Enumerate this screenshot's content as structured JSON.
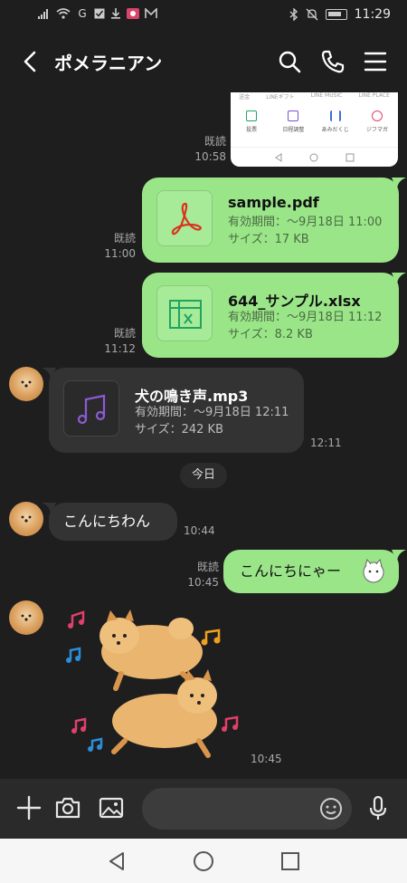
{
  "status": {
    "time": "11:29"
  },
  "header": {
    "title": "ポメラニアン"
  },
  "screenshot_preview": {
    "items": [
      "投票",
      "日程調整",
      "あみだくじ",
      "ジフマガ"
    ],
    "top_labels": [
      "送金",
      "LINEギフト",
      "LINE MUSIC",
      "LINE PLACE"
    ]
  },
  "messages": {
    "shot_read": "既読",
    "shot_time": "10:58",
    "pdf": {
      "name": "sample.pdf",
      "expiry": "有効期間：〜9月18日 11:00",
      "size": "サイズ：17 KB",
      "read": "既読",
      "time": "11:00"
    },
    "xlsx": {
      "name": "644_サンプル.xlsx",
      "expiry": "有効期間：〜9月18日 11:12",
      "size": "サイズ：8.2 KB",
      "read": "既読",
      "time": "11:12"
    },
    "mp3": {
      "name": "犬の鳴き声.mp3",
      "expiry": "有効期間：〜9月18日 12:11",
      "size": "サイズ：242 KB",
      "time": "12:11"
    },
    "today": "今日",
    "hello": {
      "text": "こんにちわん",
      "time": "10:44"
    },
    "reply": {
      "text": "こんにちにゃー",
      "read": "既読",
      "time": "10:45"
    },
    "sticker_time": "10:45"
  },
  "colors": {
    "bubble_green": "#9be589",
    "bubble_dark": "#333333",
    "pdf_red": "#d8331f",
    "xlsx_green": "#1fa463",
    "music_purple": "#8a5bd6"
  }
}
